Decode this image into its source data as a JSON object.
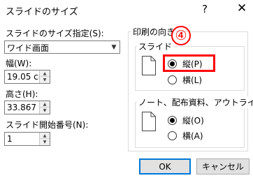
{
  "window": {
    "title": "スライドのサイズ",
    "help_glyph": "?",
    "close_glyph": "✕"
  },
  "size_spec": {
    "label": "スライドのサイズ指定(S):",
    "value": "ワイド画面"
  },
  "width": {
    "label": "幅(W):",
    "value": "19.05 cm"
  },
  "height": {
    "label": "高さ(H):",
    "value": "33.867 cm"
  },
  "start_number": {
    "label": "スライド開始番号(N):",
    "value": "1"
  },
  "orientation": {
    "group_title": "印刷の向き",
    "slides": {
      "title": "スライド",
      "portrait": "縦(P)",
      "landscape": "横(L)",
      "selected": "portrait"
    },
    "notes": {
      "title": "ノート、配布資料、アウトライン",
      "portrait": "縦(O)",
      "landscape": "横(A)",
      "selected": "portrait"
    }
  },
  "annotation": {
    "number": "④",
    "color": "#ff0000"
  },
  "buttons": {
    "ok": "OK",
    "cancel": "キャンセル"
  },
  "colors": {
    "accent": "#0078d7",
    "highlight": "#ff0000"
  }
}
